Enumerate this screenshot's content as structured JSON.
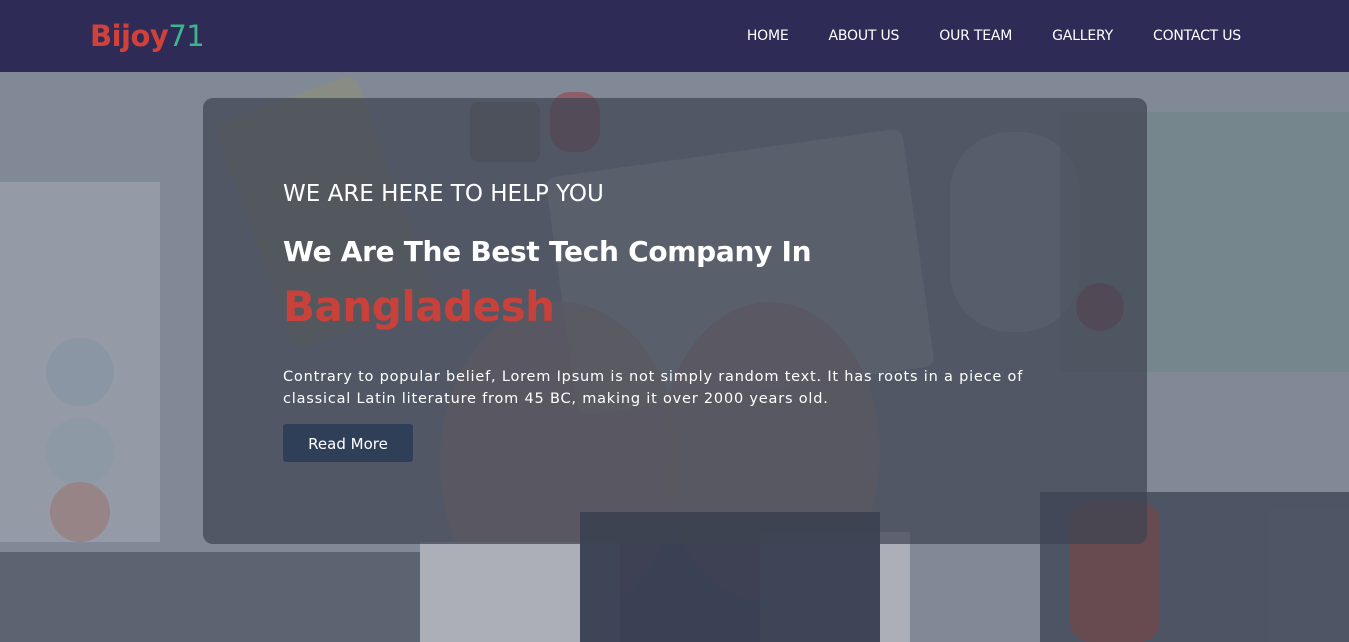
{
  "brand": {
    "part1": "Bijoy",
    "part2": "71",
    "color1": "#d0413a",
    "color2": "#3db48d"
  },
  "nav": {
    "items": [
      {
        "label": "HOME"
      },
      {
        "label": "ABOUT US"
      },
      {
        "label": "OUR TEAM"
      },
      {
        "label": "GALLERY"
      },
      {
        "label": "CONTACT US"
      }
    ]
  },
  "hero": {
    "kicker": "WE ARE HERE TO HELP YOU",
    "headline": "We Are The Best Tech Company In",
    "highlight": "Bangladesh",
    "description": "Contrary to popular belief, Lorem Ipsum is not simply random text. It has roots in a piece of classical Latin literature from 45 BC, making it over 2000 years old.",
    "button_label": "Read More",
    "highlight_color": "#c8413a",
    "background_image": "hands-typing-on-keyboard-photo"
  }
}
